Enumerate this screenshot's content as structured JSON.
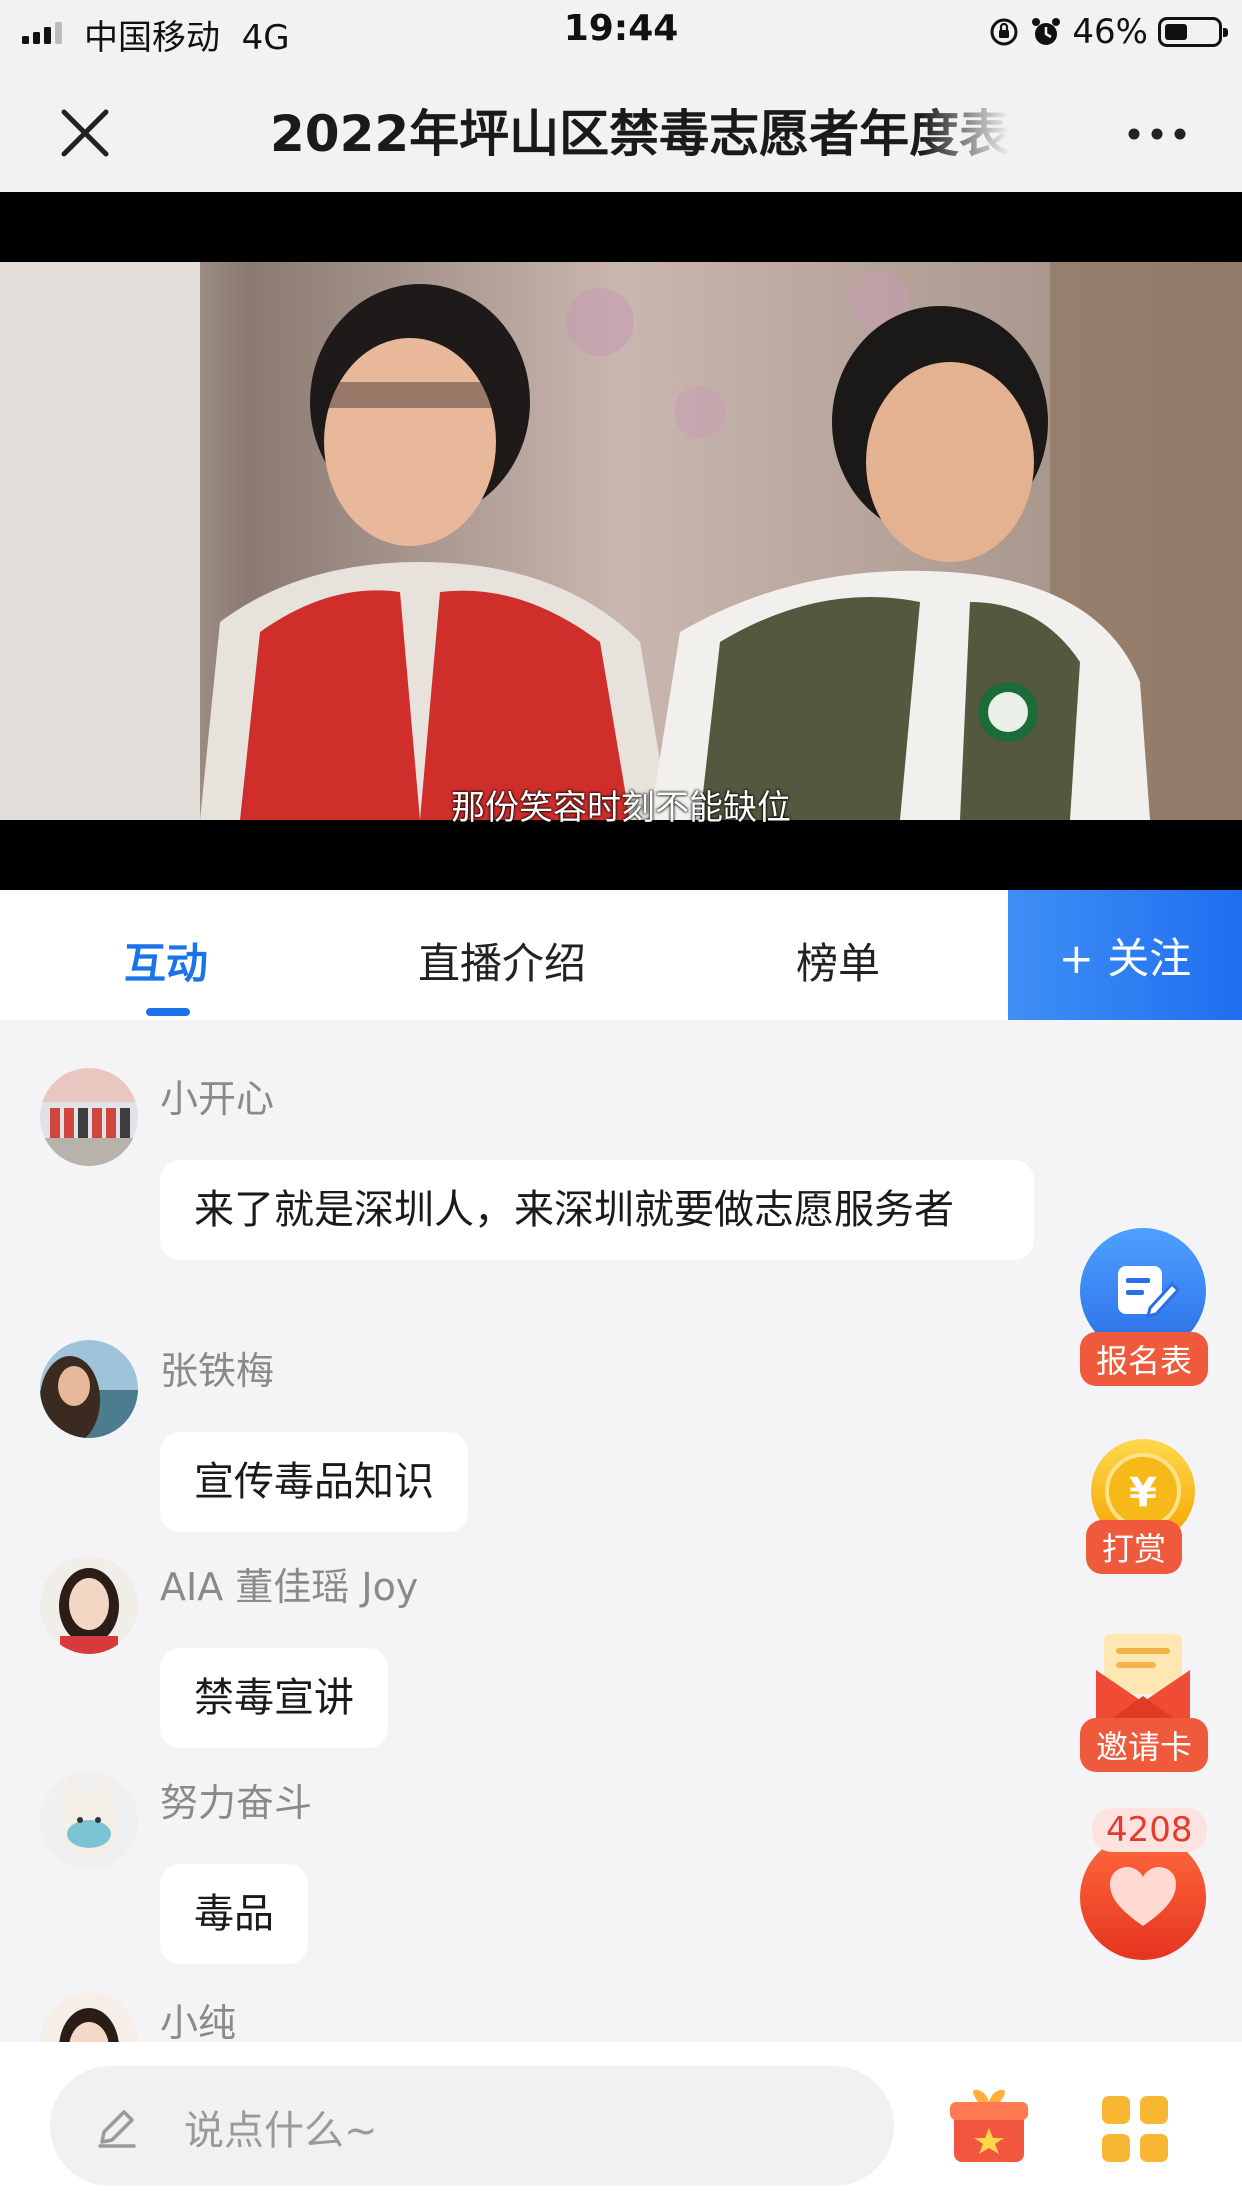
{
  "status_bar": {
    "carrier": "中国移动",
    "network": "4G",
    "time": "19:44",
    "battery": "46%"
  },
  "header": {
    "title": "2022年坪山区禁毒志愿者年度表"
  },
  "video": {
    "subtitle": "那份笑容时刻不能缺位"
  },
  "tabs": {
    "items": [
      {
        "label": "互动"
      },
      {
        "label": "直播介绍"
      },
      {
        "label": "榜单"
      }
    ],
    "follow_label": "+ 关注"
  },
  "messages": [
    {
      "user": "小开心",
      "text": "来了就是深圳人，来深圳就要做志愿服务者"
    },
    {
      "user": "张铁梅",
      "text": "宣传毒品知识"
    },
    {
      "user": "AIA 董佳瑶 Joy",
      "text": "禁毒宣讲"
    },
    {
      "user": "努力奋斗",
      "text": "毒品"
    },
    {
      "user": "小纯",
      "text": ""
    }
  ],
  "side_actions": {
    "signup_label": "报名表",
    "reward_label": "打赏",
    "invite_label": "邀请卡",
    "like_count": "4208"
  },
  "bottom_bar": {
    "input_placeholder": "说点什么~"
  },
  "colors": {
    "accent": "#1a73e8",
    "badge": "#f05a3c",
    "like": "#e53b2c"
  }
}
